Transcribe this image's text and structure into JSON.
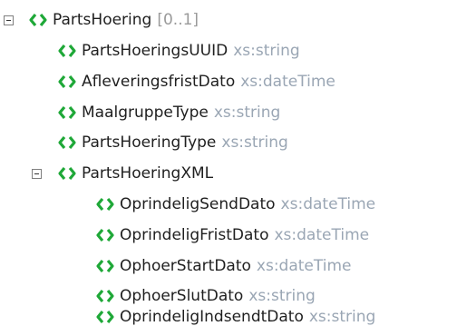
{
  "colors": {
    "icon": "#1fa838",
    "name": "#1f1f1f",
    "type": "#9aa6b4",
    "cardinality": "#9a9a9a"
  },
  "tree": {
    "root": {
      "name": "PartsHoering",
      "cardinality": "[0..1]",
      "expanded": true,
      "icon": "element-icon"
    },
    "children": [
      {
        "name": "PartsHoeringsUUID",
        "type": "xs:string",
        "icon": "element-icon"
      },
      {
        "name": "AfleveringsfristDato",
        "type": "xs:dateTime",
        "icon": "element-icon"
      },
      {
        "name": "MaalgruppeType",
        "type": "xs:string",
        "icon": "element-icon"
      },
      {
        "name": "PartsHoeringType",
        "type": "xs:string",
        "icon": "element-icon"
      },
      {
        "name": "PartsHoeringXML",
        "expanded": true,
        "icon": "element-icon",
        "children": [
          {
            "name": "OprindeligSendDato",
            "type": "xs:dateTime",
            "icon": "element-icon"
          },
          {
            "name": "OprindeligFristDato",
            "type": "xs:dateTime",
            "icon": "element-icon"
          },
          {
            "name": "OphoerStartDato",
            "type": "xs:dateTime",
            "icon": "element-icon"
          },
          {
            "name": "OphoerSlutDato",
            "type": "xs:string",
            "icon": "element-icon"
          },
          {
            "name": "OprindeligIndsendtDato",
            "type": "xs:string",
            "icon": "element-icon"
          }
        ]
      }
    ]
  }
}
